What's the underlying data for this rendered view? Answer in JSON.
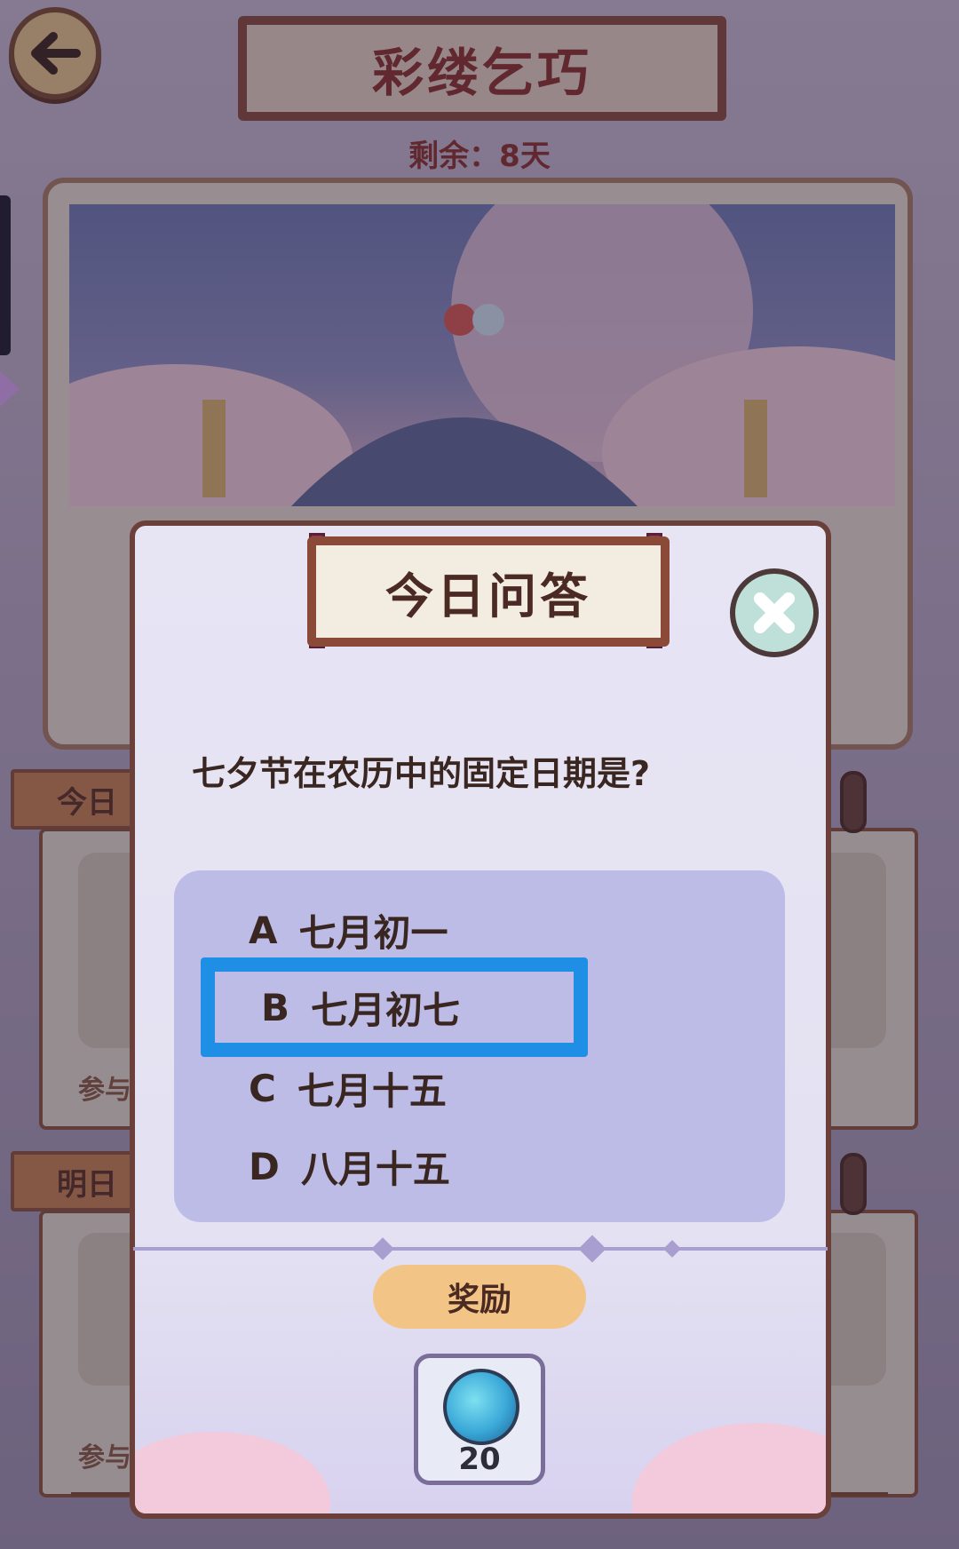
{
  "header": {
    "title": "彩缕乞巧",
    "remaining": "剩余：8天"
  },
  "sections": {
    "today_tag": "今日",
    "tomorrow_tag": "明日",
    "join_label": "参与"
  },
  "quiz_modal": {
    "title": "今日问答",
    "question": "七夕节在农历中的固定日期是?",
    "options": [
      {
        "letter": "A",
        "text": "七月初一",
        "selected": false
      },
      {
        "letter": "B",
        "text": "七月初七",
        "selected": true
      },
      {
        "letter": "C",
        "text": "七月十五",
        "selected": false
      },
      {
        "letter": "D",
        "text": "八月十五",
        "selected": false
      }
    ],
    "reward_label": "奖励",
    "reward_item": {
      "icon": "swirl-orb-icon",
      "quantity": "20"
    }
  },
  "colors": {
    "selection": "#1f8fe5",
    "options_panel": "#bcbce6",
    "title_text": "#8b2f28"
  }
}
